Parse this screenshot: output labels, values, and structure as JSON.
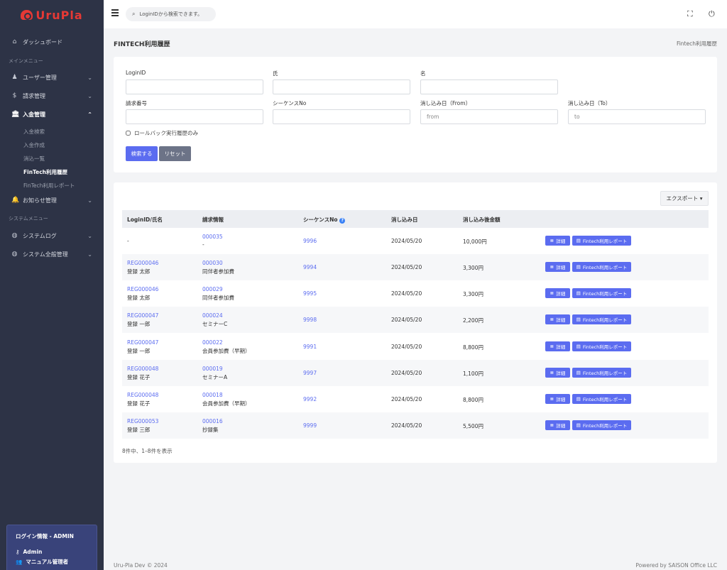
{
  "sidebar": {
    "logo": "UruPla",
    "dashboard": "ダッシュボード",
    "section_main": "メインメニュー",
    "users": "ユーザー管理",
    "billing": "請求管理",
    "payment": "入金管理",
    "payment_sub": [
      "入金検索",
      "入金作成",
      "消込一覧",
      "FinTech利用履歴",
      "FinTech利用レポート"
    ],
    "notice": "お知らせ管理",
    "section_system": "システムメニュー",
    "syslog": "システムログ",
    "sysall": "システム全般管理",
    "login_title": "ログイン情報 - ADMIN",
    "login_user": "Admin",
    "login_role": "マニュアル管理者"
  },
  "topbar": {
    "search_placeholder": "LoginIDから検索できます。"
  },
  "page": {
    "title": "FINTECH利用履歴",
    "breadcrumb": "Fintech利用履歴"
  },
  "form": {
    "loginid_label": "LoginID",
    "sei_label": "氏",
    "mei_label": "名",
    "invoice_label": "請求番号",
    "seq_label": "シーケンスNo",
    "from_label": "消し込み日（From）",
    "to_label": "消し込み日（To）",
    "from_placeholder": "from",
    "to_placeholder": "to",
    "rollback_label": "ロールバック実行履歴のみ",
    "search_button": "検索する",
    "reset_button": "リセット"
  },
  "table": {
    "export_label": "エクスポート ▾",
    "headers": [
      "LoginID/氏名",
      "請求情報",
      "シーケンスNo",
      "消し込み日",
      "消し込み後金額"
    ],
    "detail_label": "詳細",
    "report_label": "Fintech利用レポート",
    "rows": [
      {
        "loginid": "-",
        "name": "",
        "invoice": "000035",
        "item": "-",
        "seq": "9996",
        "date": "2024/05/20",
        "amount": "10,000円"
      },
      {
        "loginid": "REG000046",
        "name": "登録 太郎",
        "invoice": "000030",
        "item": "同伴者参加費",
        "seq": "9994",
        "date": "2024/05/20",
        "amount": "3,300円"
      },
      {
        "loginid": "REG000046",
        "name": "登録 太郎",
        "invoice": "000029",
        "item": "同伴者参加費",
        "seq": "9995",
        "date": "2024/05/20",
        "amount": "3,300円"
      },
      {
        "loginid": "REG000047",
        "name": "登録 一郎",
        "invoice": "000024",
        "item": "セミナーC",
        "seq": "9998",
        "date": "2024/05/20",
        "amount": "2,200円"
      },
      {
        "loginid": "REG000047",
        "name": "登録 一郎",
        "invoice": "000022",
        "item": "会員参加費（早期）",
        "seq": "9991",
        "date": "2024/05/20",
        "amount": "8,800円"
      },
      {
        "loginid": "REG000048",
        "name": "登録 花子",
        "invoice": "000019",
        "item": "セミナーA",
        "seq": "9997",
        "date": "2024/05/20",
        "amount": "1,100円"
      },
      {
        "loginid": "REG000048",
        "name": "登録 花子",
        "invoice": "000018",
        "item": "会員参加費（早期）",
        "seq": "9992",
        "date": "2024/05/20",
        "amount": "8,800円"
      },
      {
        "loginid": "REG000053",
        "name": "登録 三郎",
        "invoice": "000016",
        "item": "抄録集",
        "seq": "9999",
        "date": "2024/05/20",
        "amount": "5,500円"
      }
    ],
    "footer_info": "8件中、1–8件を表示"
  },
  "footer": {
    "left": "Uru-Pla Dev © 2024",
    "right": "Powered by SAISON Office LLC"
  }
}
